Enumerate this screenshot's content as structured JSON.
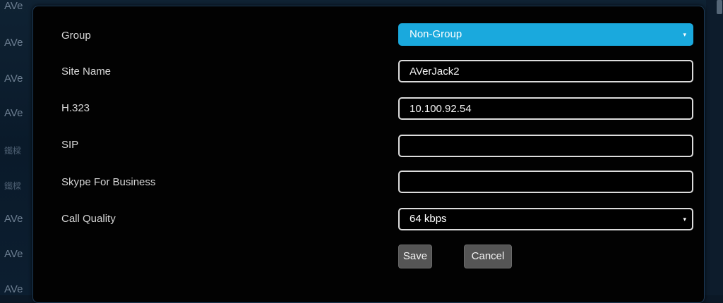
{
  "background_list": {
    "items": [
      "AVe",
      "AVe",
      "AVe",
      "AVe",
      "鐵樑",
      "鐵樑",
      "AVe",
      "AVe",
      "AVe"
    ]
  },
  "form": {
    "fields": [
      {
        "label": "Group",
        "type": "select",
        "value": "Non-Group"
      },
      {
        "label": "Site Name",
        "type": "text",
        "value": "AVerJack2"
      },
      {
        "label": "H.323",
        "type": "text",
        "value": "10.100.92.54"
      },
      {
        "label": "SIP",
        "type": "text",
        "value": ""
      },
      {
        "label": "Skype For Business",
        "type": "text",
        "value": ""
      },
      {
        "label": "Call Quality",
        "type": "select",
        "value": "64 kbps"
      }
    ]
  },
  "buttons": {
    "save_label": "Save",
    "cancel_label": "Cancel"
  },
  "icons": {
    "select_caret": "▾"
  },
  "colors": {
    "dialog_bg": "#020202",
    "group_select_bg": "#1aa9dd",
    "button_bg": "#555555",
    "field_border": "#dcdcdc"
  }
}
